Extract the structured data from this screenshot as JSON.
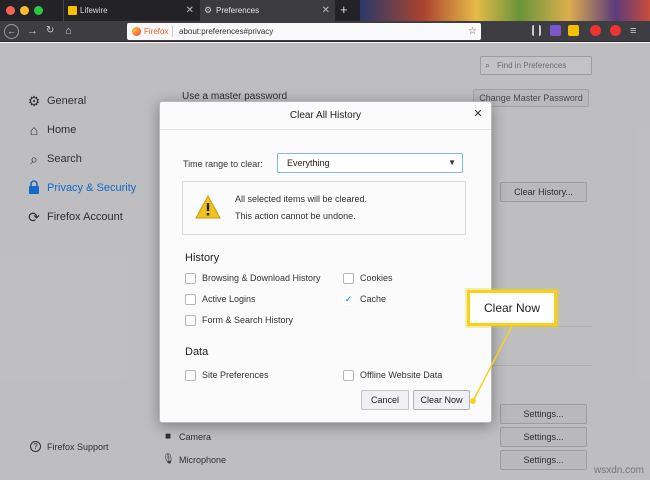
{
  "tabs": [
    {
      "label": "Lifewire"
    },
    {
      "label": "Preferences"
    }
  ],
  "urlbar": {
    "identity_label": "Firefox",
    "url": "about:preferences#privacy"
  },
  "prefs": {
    "find_placeholder": "Find in Preferences",
    "sidebar": [
      {
        "label": "General",
        "icon": "gear-icon"
      },
      {
        "label": "Home",
        "icon": "home-icon"
      },
      {
        "label": "Search",
        "icon": "search-icon"
      },
      {
        "label": "Privacy & Security",
        "icon": "lock-icon",
        "active": true
      },
      {
        "label": "Firefox Account",
        "icon": "sync-icon"
      }
    ],
    "support_label": "Firefox Support",
    "master_password_label": "Use a master password",
    "change_master_button": "Change Master Password",
    "clear_history_button": "Clear History...",
    "settings_button": "Settings...",
    "permissions": [
      {
        "label": "Camera",
        "icon": "camera-icon"
      },
      {
        "label": "Microphone",
        "icon": "microphone-icon"
      }
    ]
  },
  "dialog": {
    "title": "Clear All History",
    "range_label": "Time range to clear:",
    "range_value": "Everything",
    "warning_line1": "All selected items will be cleared.",
    "warning_line2": "This action cannot be undone.",
    "history_title": "History",
    "history_items": [
      {
        "label": "Browsing & Download History",
        "checked": false
      },
      {
        "label": "Cookies",
        "checked": false
      },
      {
        "label": "Active Logins",
        "checked": false
      },
      {
        "label": "Cache",
        "checked": true
      },
      {
        "label": "Form & Search History",
        "checked": false
      }
    ],
    "data_title": "Data",
    "data_items": [
      {
        "label": "Site Preferences",
        "checked": false
      },
      {
        "label": "Offline Website Data",
        "checked": false
      }
    ],
    "cancel_button": "Cancel",
    "clear_now_button": "Clear Now"
  },
  "callout": {
    "label": "Clear Now",
    "color": "#f6d21b"
  },
  "watermark": "wsxdn.com",
  "colors": {
    "accent": "#0a84ff",
    "callout": "#f6d21b",
    "warning": "#f0c419"
  }
}
